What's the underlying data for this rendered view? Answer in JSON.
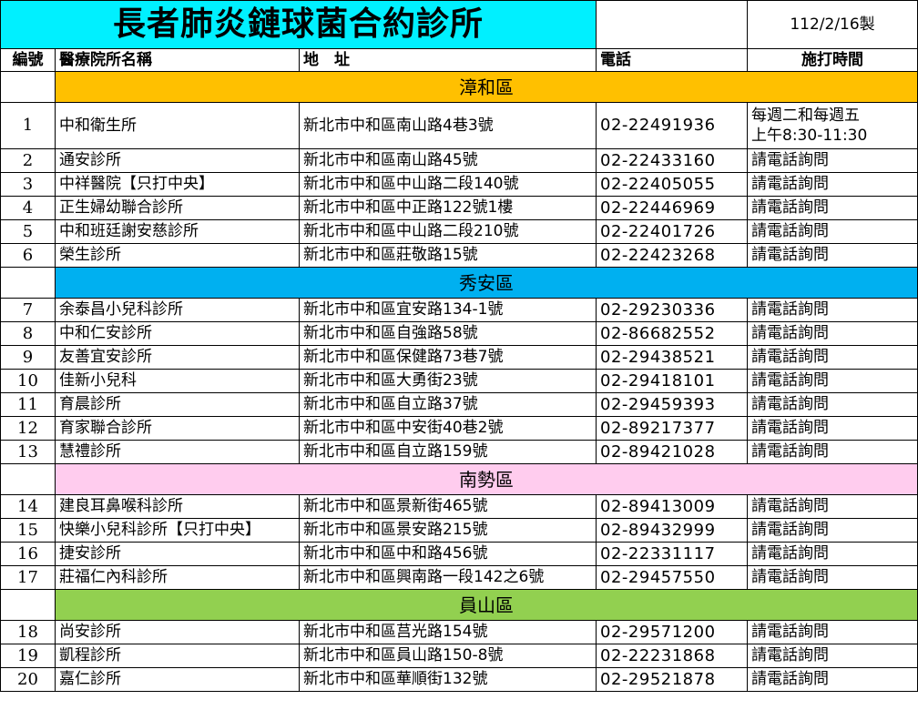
{
  "title": "長者肺炎鏈球菌合約診所",
  "made_date": "112/2/16製",
  "headers": {
    "num": "編號",
    "name": "醫療院所名稱",
    "address": "地　址",
    "phone": "電話",
    "hours": "施打時間"
  },
  "colors": {
    "title_bg": "#00f0ff",
    "zhanghe": "#ffc000",
    "xiuan": "#00b0f0",
    "nanshi": "#ffccee",
    "yuanshan": "#92d050"
  },
  "regions": [
    {
      "name": "漳和區",
      "color": "#ffc000",
      "rows": [
        {
          "num": "1",
          "name": "中和衛生所",
          "address": "新北市中和區南山路4巷3號",
          "phone": "02-22491936",
          "hours_line1": "每週二和每週五",
          "hours_line2": "上午8:30-11:30"
        },
        {
          "num": "2",
          "name": "通安診所",
          "address": "新北市中和區南山路45號",
          "phone": "02-22433160",
          "hours": "請電話詢問"
        },
        {
          "num": "3",
          "name": "中祥醫院【只打中央】",
          "address": "新北市中和區中山路二段140號",
          "phone": "02-22405055",
          "hours": "請電話詢問"
        },
        {
          "num": "4",
          "name": "正生婦幼聯合診所",
          "address": "新北市中和區中正路122號1樓",
          "phone": "02-22446969",
          "hours": "請電話詢問"
        },
        {
          "num": "5",
          "name": "中和班廷謝安慈診所",
          "address": "新北市中和區中山路二段210號",
          "phone": "02-22401726",
          "hours": "請電話詢問"
        },
        {
          "num": "6",
          "name": "榮生診所",
          "address": "新北市中和區莊敬路15號",
          "phone": "02-22423268",
          "hours": "請電話詢問"
        }
      ]
    },
    {
      "name": "秀安區",
      "color": "#00b0f0",
      "rows": [
        {
          "num": "7",
          "name": "余泰昌小兒科診所",
          "address": "新北市中和區宜安路134-1號",
          "phone": "02-29230336",
          "hours": "請電話詢問"
        },
        {
          "num": "8",
          "name": "中和仁安診所",
          "address": "新北市中和區自強路58號",
          "phone": "02-86682552",
          "hours": "請電話詢問"
        },
        {
          "num": "9",
          "name": "友善宜安診所",
          "address": "新北市中和區保健路73巷7號",
          "phone": "02-29438521",
          "hours": "請電話詢問"
        },
        {
          "num": "10",
          "name": "佳新小兒科",
          "address": "新北市中和區大勇街23號",
          "phone": "02-29418101",
          "hours": "請電話詢問"
        },
        {
          "num": "11",
          "name": "育晨診所",
          "address": "新北市中和區自立路37號",
          "phone": "02-29459393",
          "hours": "請電話詢問"
        },
        {
          "num": "12",
          "name": "育家聯合診所",
          "address": "新北市中和區中安街40巷2號",
          "phone": "02-89217377",
          "hours": "請電話詢問"
        },
        {
          "num": "13",
          "name": "慧禮診所",
          "address": "新北市中和區自立路159號",
          "phone": "02-89421028",
          "hours": "請電話詢問"
        }
      ]
    },
    {
      "name": "南勢區",
      "color": "#ffccee",
      "rows": [
        {
          "num": "14",
          "name": "建良耳鼻喉科診所",
          "address": "新北市中和區景新街465號",
          "phone": "02-89413009",
          "hours": "請電話詢問"
        },
        {
          "num": "15",
          "name": "快樂小兒科診所【只打中央】",
          "address": "新北市中和區景安路215號",
          "phone": "02-89432999",
          "hours": "請電話詢問"
        },
        {
          "num": "16",
          "name": "捷安診所",
          "address": "新北市中和區中和路456號",
          "phone": "02-22331117",
          "hours": "請電話詢問"
        },
        {
          "num": "17",
          "name": "莊福仁內科診所",
          "address": "新北市中和區興南路一段142之6號",
          "phone": "02-29457550",
          "hours": "請電話詢問"
        }
      ]
    },
    {
      "name": "員山區",
      "color": "#92d050",
      "rows": [
        {
          "num": "18",
          "name": "尚安診所",
          "address": "新北市中和區莒光路154號",
          "phone": "02-29571200",
          "hours": "請電話詢問"
        },
        {
          "num": "19",
          "name": "凱程診所",
          "address": "新北市中和區員山路150-8號",
          "phone": "02-22231868",
          "hours": "請電話詢問"
        },
        {
          "num": "20",
          "name": "嘉仁診所",
          "address": "新北市中和區華順街132號",
          "phone": "02-29521878",
          "hours": "請電話詢問"
        }
      ]
    }
  ]
}
